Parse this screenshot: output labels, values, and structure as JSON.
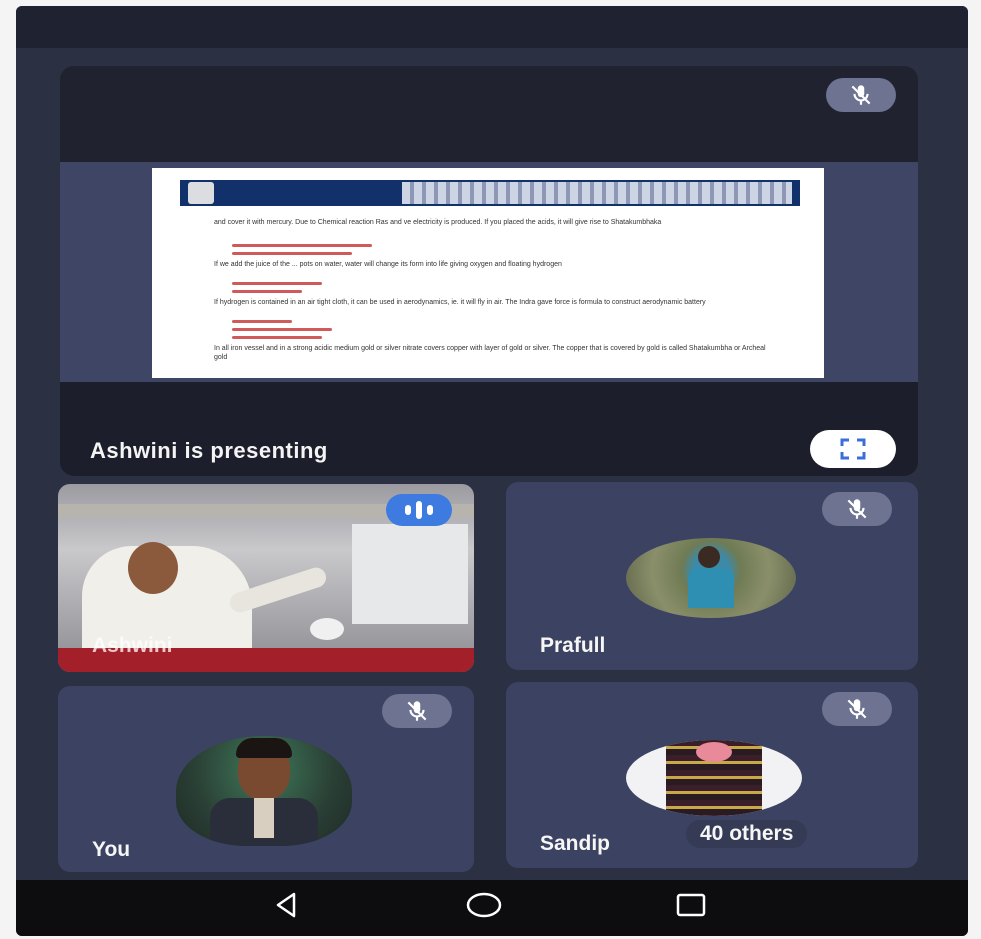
{
  "presentation": {
    "label": "Ashwini is presenting",
    "slide_text_lines": [
      "and cover it with mercury. Due to Chemical reaction Ras and ve electricity is produced. If you placed the acids, it will give rise to Shatakumbhaka",
      "If we add the juice of the ... pots on water, water will change its form into life giving oxygen and floating hydrogen",
      "If hydrogen is contained in an air tight cloth, it can be used in aerodynamics, ie. it will fly in air. The Indra gave force is formula to construct aerodynamic battery",
      "In all iron vessel and in a strong acidic medium gold or silver nitrate covers copper with layer of gold or silver. The copper that is covered by gold is called Shatakumbha or Archeal gold"
    ]
  },
  "participants": [
    {
      "name": "Ashwini",
      "status": "speaking"
    },
    {
      "name": "Prafull",
      "status": "muted"
    },
    {
      "name": "You",
      "status": "muted"
    },
    {
      "name": "Sandip",
      "status": "muted",
      "others_label": "40 others"
    }
  ],
  "icons": {
    "mic_off": "mic-off-icon",
    "speaking": "audio-level-icon",
    "fullscreen": "fullscreen-icon",
    "back": "nav-back-icon",
    "home": "nav-home-icon",
    "recents": "nav-recents-icon"
  },
  "colors": {
    "background": "#2c3043",
    "tile": "#3c4261",
    "speaking_accent": "#3d7be0",
    "mute_badge": "#6d7390"
  }
}
